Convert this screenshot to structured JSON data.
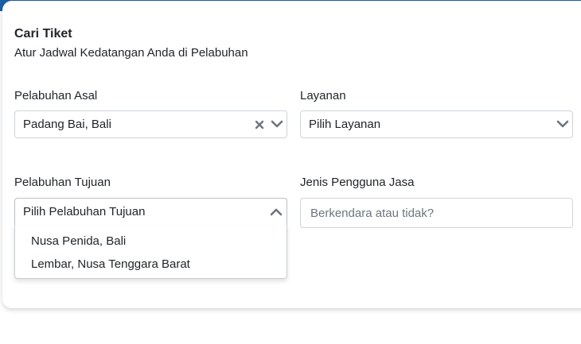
{
  "header": {
    "title": "Cari Tiket",
    "subtitle": "Atur Jadwal Kedatangan Anda di Pelabuhan"
  },
  "form": {
    "origin": {
      "label": "Pelabuhan Asal",
      "value": "Padang Bai, Bali",
      "clear_icon": "close-icon",
      "toggle_icon": "chevron-down-icon"
    },
    "service": {
      "label": "Layanan",
      "value": "Pilih Layanan",
      "toggle_icon": "chevron-down-icon"
    },
    "destination": {
      "label": "Pelabuhan Tujuan",
      "value": "Pilih Pelabuhan Tujuan",
      "toggle_icon": "chevron-up-icon",
      "options": [
        "Nusa Penida, Bali",
        "Lembar, Nusa Tenggara Barat"
      ]
    },
    "user_type": {
      "label": "Jenis Pengguna Jasa",
      "placeholder": "Berkendara atau tidak?"
    }
  },
  "colors": {
    "accent": "#1a5fa3",
    "border": "#ced4da",
    "icon": "#6c757d",
    "text": "#212529"
  }
}
